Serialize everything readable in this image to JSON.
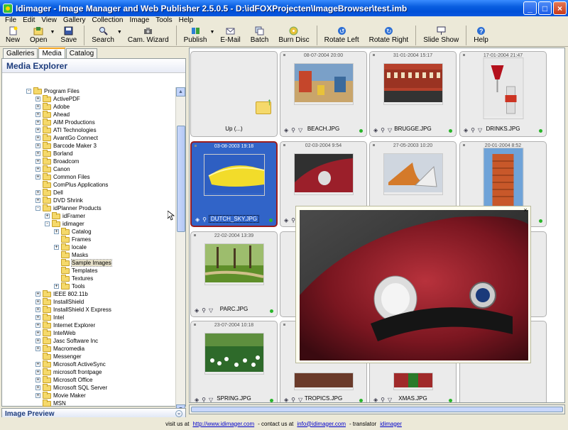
{
  "window": {
    "title": "Idimager - Image Manager and Web Publisher 2.5.0.5 - D:\\idFOXProjecten\\ImageBrowser\\test.imb",
    "minimize": "_",
    "maximize": "□",
    "close": "×"
  },
  "menu": [
    "File",
    "Edit",
    "View",
    "Gallery",
    "Collection",
    "Image",
    "Tools",
    "Help"
  ],
  "toolbar": [
    {
      "label": "New",
      "icon": "new-icon"
    },
    {
      "label": "Open",
      "icon": "open-icon"
    },
    {
      "label": "Save",
      "icon": "save-icon"
    },
    {
      "label": "Search",
      "icon": "search-icon"
    },
    {
      "label": "Cam. Wizard",
      "icon": "camera-icon"
    },
    {
      "label": "Publish",
      "icon": "publish-icon"
    },
    {
      "label": "E-Mail",
      "icon": "email-icon"
    },
    {
      "label": "Batch",
      "icon": "batch-icon"
    },
    {
      "label": "Burn Disc",
      "icon": "disc-icon"
    },
    {
      "label": "Rotate Left",
      "icon": "rotate-left-icon"
    },
    {
      "label": "Rotate Right",
      "icon": "rotate-right-icon"
    },
    {
      "label": "Slide Show",
      "icon": "slideshow-icon"
    },
    {
      "label": "Help",
      "icon": "help-icon"
    }
  ],
  "tabs": [
    "Galleries",
    "Media",
    "Catalog"
  ],
  "explorer": {
    "header": "Media Explorer",
    "preview_label": "Image Preview",
    "tree": [
      {
        "label": "Program Files",
        "level": 0,
        "pm": "-"
      },
      {
        "label": "ActivePDF",
        "level": 1,
        "pm": "+"
      },
      {
        "label": "Adobe",
        "level": 1,
        "pm": "+"
      },
      {
        "label": "Ahead",
        "level": 1,
        "pm": "+"
      },
      {
        "label": "AIM Productions",
        "level": 1,
        "pm": "+"
      },
      {
        "label": "ATI Technologies",
        "level": 1,
        "pm": "+"
      },
      {
        "label": "AvantGo Connect",
        "level": 1,
        "pm": "+"
      },
      {
        "label": "Barcode Maker 3",
        "level": 1,
        "pm": "+"
      },
      {
        "label": "Borland",
        "level": 1,
        "pm": "+"
      },
      {
        "label": "Broadcom",
        "level": 1,
        "pm": "+"
      },
      {
        "label": "Canon",
        "level": 1,
        "pm": "+"
      },
      {
        "label": "Common Files",
        "level": 1,
        "pm": "+"
      },
      {
        "label": "ComPlus Applications",
        "level": 1,
        "pm": ""
      },
      {
        "label": "Dell",
        "level": 1,
        "pm": "+"
      },
      {
        "label": "DVD Shrink",
        "level": 1,
        "pm": "+"
      },
      {
        "label": "idPlanner Products",
        "level": 1,
        "pm": "-"
      },
      {
        "label": "idFramer",
        "level": 2,
        "pm": "+"
      },
      {
        "label": "idimager",
        "level": 2,
        "pm": "-"
      },
      {
        "label": "Catalog",
        "level": 3,
        "pm": "+"
      },
      {
        "label": "Frames",
        "level": 3,
        "pm": ""
      },
      {
        "label": "locale",
        "level": 3,
        "pm": "+"
      },
      {
        "label": "Masks",
        "level": 3,
        "pm": ""
      },
      {
        "label": "Sample Images",
        "level": 3,
        "pm": "",
        "selected": true
      },
      {
        "label": "Templates",
        "level": 3,
        "pm": ""
      },
      {
        "label": "Textures",
        "level": 3,
        "pm": ""
      },
      {
        "label": "Tools",
        "level": 3,
        "pm": "+"
      },
      {
        "label": "IEEE 802.11b",
        "level": 1,
        "pm": "+"
      },
      {
        "label": "InstallShield",
        "level": 1,
        "pm": "+"
      },
      {
        "label": "InstallShield X Express",
        "level": 1,
        "pm": "+"
      },
      {
        "label": "Intel",
        "level": 1,
        "pm": "+"
      },
      {
        "label": "Internet Explorer",
        "level": 1,
        "pm": "+"
      },
      {
        "label": "IntelWeb",
        "level": 1,
        "pm": "+"
      },
      {
        "label": "Jasc Software Inc",
        "level": 1,
        "pm": "+"
      },
      {
        "label": "Macromedia",
        "level": 1,
        "pm": "+"
      },
      {
        "label": "Messenger",
        "level": 1,
        "pm": ""
      },
      {
        "label": "Microsoft ActiveSync",
        "level": 1,
        "pm": "+"
      },
      {
        "label": "microsoft frontpage",
        "level": 1,
        "pm": "+"
      },
      {
        "label": "Microsoft Office",
        "level": 1,
        "pm": "+"
      },
      {
        "label": "Microsoft SQL Server",
        "level": 1,
        "pm": "+"
      },
      {
        "label": "Movie Maker",
        "level": 1,
        "pm": "+"
      },
      {
        "label": "MSN",
        "level": 1,
        "pm": ""
      }
    ]
  },
  "grid": [
    {
      "name": "Up (...)",
      "date": "",
      "kind": "up"
    },
    {
      "name": "BEACH.JPG",
      "date": "08-07-2004 20:00",
      "kind": "beach"
    },
    {
      "name": "BRUGGE.JPG",
      "date": "31-01-2004 15:17",
      "kind": "brugge"
    },
    {
      "name": "DRINKS.JPG",
      "date": "17-01-2004 21:47",
      "kind": "drinks"
    },
    {
      "name": "DUTCH_SKY.JPG",
      "date": "03-08-2003 19:18",
      "kind": "sky",
      "selected": true
    },
    {
      "name": "",
      "date": "02-03-2004 9:54",
      "kind": "car"
    },
    {
      "name": "",
      "date": "27-05-2003 10:20",
      "kind": "shoes"
    },
    {
      "name": "",
      "date": "20-01-2004 8:52",
      "kind": "tower"
    },
    {
      "name": "PARC.JPG",
      "date": "22-02-2004 13:39",
      "kind": "parc"
    },
    {
      "name": "",
      "date": "",
      "kind": "hidden"
    },
    {
      "name": "",
      "date": "",
      "kind": "hidden"
    },
    {
      "name": "",
      "date": "",
      "kind": "hidden"
    },
    {
      "name": "SPRING.JPG",
      "date": "23-07-2004 10:18",
      "kind": "spring"
    },
    {
      "name": "TROPICS.JPG",
      "date": "",
      "kind": "tropics"
    },
    {
      "name": "XMAS.JPG",
      "date": "",
      "kind": "xmas"
    },
    {
      "name": "",
      "date": "",
      "kind": "empty"
    }
  ],
  "popup_close": "×",
  "status": {
    "prefix": "visit us at",
    "site": "http://www.idimager.com",
    "middle": "- contact us at",
    "email": "info@idimager.com",
    "suffix": "- translator",
    "translator": "idimager"
  }
}
